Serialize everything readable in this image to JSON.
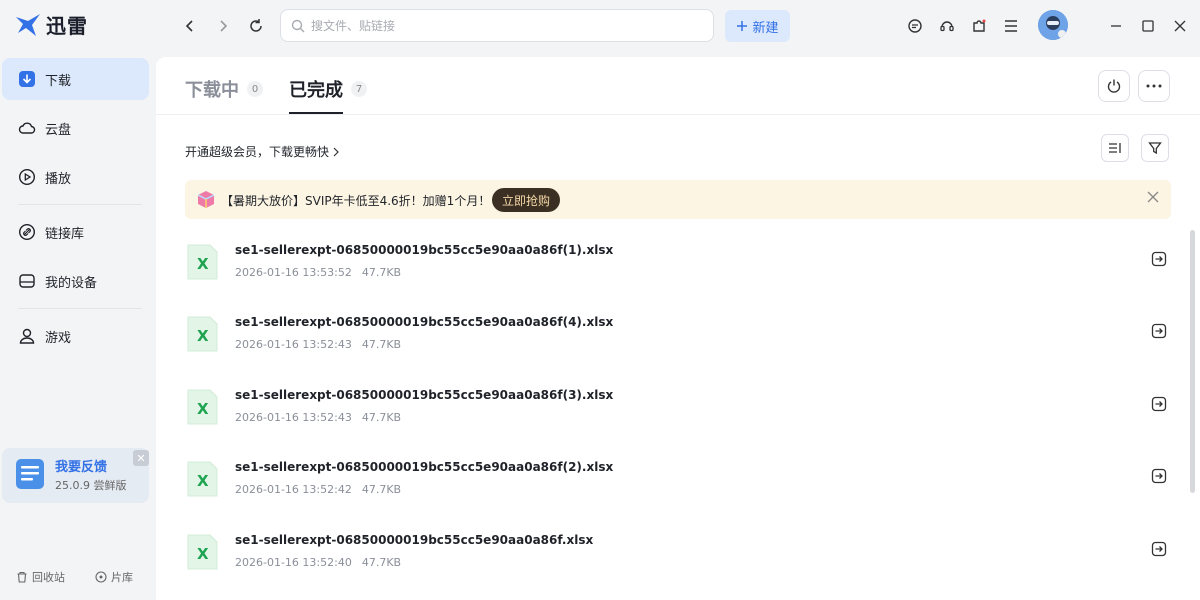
{
  "app": {
    "logo_text": "迅雷",
    "brand_color": "#3271e6"
  },
  "toolbar": {
    "search_placeholder": "搜文件、贴链接",
    "new_label": "新建",
    "icons": [
      "back-icon",
      "forward-icon",
      "refresh-icon",
      "message-icon",
      "headset-icon",
      "puzzle-icon",
      "menu-icon"
    ]
  },
  "sidebar": {
    "items": [
      {
        "label": "下载",
        "icon": "download-icon"
      },
      {
        "label": "云盘",
        "icon": "cloud-icon"
      },
      {
        "label": "播放",
        "icon": "play-icon"
      },
      {
        "label": "链接库",
        "icon": "link-icon"
      },
      {
        "label": "我的设备",
        "icon": "device-icon"
      },
      {
        "label": "游戏",
        "icon": "user-icon"
      }
    ],
    "feedback": {
      "title": "我要反馈",
      "version": "25.0.9 尝鲜版"
    },
    "bottom": {
      "recycle": "回收站",
      "library": "片库"
    }
  },
  "tabs": [
    {
      "label": "下载中",
      "count": "0"
    },
    {
      "label": "已完成",
      "count": "7"
    }
  ],
  "promo": {
    "line": "开通超级会员，下载更畅快",
    "banner_text": "【暑期大放价】SVIP年卡低至4.6折！加赠1个月！",
    "banner_button": "立即抢购"
  },
  "files": [
    {
      "name": "se1-sellerexpt-06850000019bc55cc5e90aa0a86f(1).xlsx",
      "time": "2026-01-16 13:53:52",
      "size": "47.7KB"
    },
    {
      "name": "se1-sellerexpt-06850000019bc55cc5e90aa0a86f(4).xlsx",
      "time": "2026-01-16 13:52:43",
      "size": "47.7KB"
    },
    {
      "name": "se1-sellerexpt-06850000019bc55cc5e90aa0a86f(3).xlsx",
      "time": "2026-01-16 13:52:43",
      "size": "47.7KB"
    },
    {
      "name": "se1-sellerexpt-06850000019bc55cc5e90aa0a86f(2).xlsx",
      "time": "2026-01-16 13:52:42",
      "size": "47.7KB"
    },
    {
      "name": "se1-sellerexpt-06850000019bc55cc5e90aa0a86f.xlsx",
      "time": "2026-01-16 13:52:40",
      "size": "47.7KB"
    }
  ]
}
